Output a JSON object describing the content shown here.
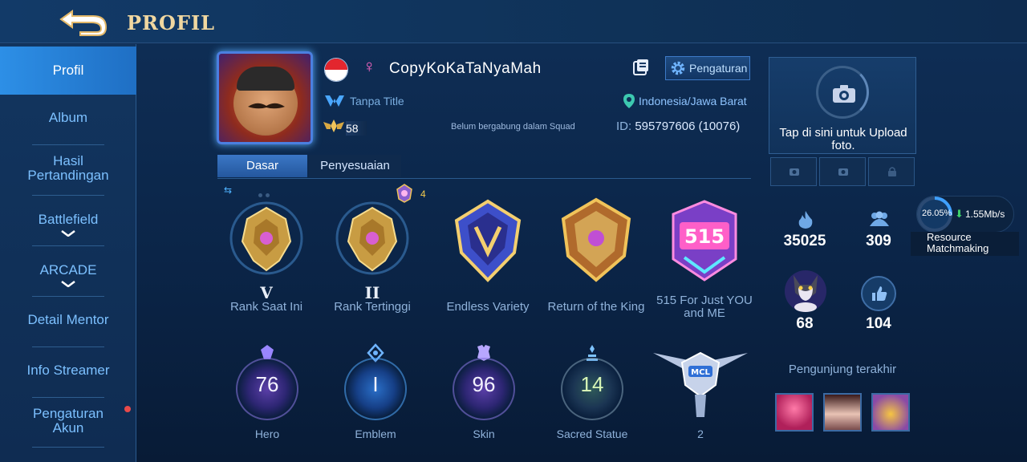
{
  "header": {
    "title": "PROFIL"
  },
  "sidebar": {
    "items": [
      {
        "label": "Profil"
      },
      {
        "label": "Album"
      },
      {
        "label": "Hasil Pertandingan"
      },
      {
        "label": "Battlefield"
      },
      {
        "label": "ARCADE"
      },
      {
        "label": "Detail Mentor"
      },
      {
        "label": "Info Streamer"
      },
      {
        "label": "Pengaturan Akun"
      }
    ]
  },
  "profile": {
    "username": "CopyKoKaTaNyaMah",
    "gender_symbol": "♀",
    "title": "Tanpa Title",
    "level": "58",
    "squad": "Belum bergabung dalam Squad",
    "settings_label": "Pengaturan",
    "location": "Indonesia/Jawa Barat",
    "id_label": "ID:",
    "id_value": "595797606 (10076)"
  },
  "tabs": [
    {
      "label": "Dasar"
    },
    {
      "label": "Penyesuaian"
    }
  ],
  "badge_count": "4",
  "achievements": [
    {
      "label": "Rank Saat Ini",
      "tier": "V"
    },
    {
      "label": "Rank Tertinggi",
      "tier": "II"
    },
    {
      "label": "Endless Variety"
    },
    {
      "label": "Return of the King"
    },
    {
      "label": "515 For Just YOU and ME"
    }
  ],
  "stats": [
    {
      "label": "Hero",
      "value": "76"
    },
    {
      "label": "Emblem",
      "value": "I"
    },
    {
      "label": "Skin",
      "value": "96"
    },
    {
      "label": "Sacred Statue",
      "value": "14"
    },
    {
      "label": "2",
      "badge_text": "MCL"
    }
  ],
  "right_panel": {
    "upload_text": "Tap di sini untuk Upload foto.",
    "popularity": "35025",
    "friends": "309",
    "pet_value": "68",
    "likes": "104",
    "visitors_title": "Pengunjung terakhir"
  },
  "network": {
    "percent": "26.05%",
    "speed": "1.55Mb/s",
    "resource_label": "Resource",
    "matchmaking_label": "Matchmaking"
  },
  "colors": {
    "accent": "#2d8fe6",
    "gold": "#f0d7a0",
    "background": "#0b2548"
  }
}
